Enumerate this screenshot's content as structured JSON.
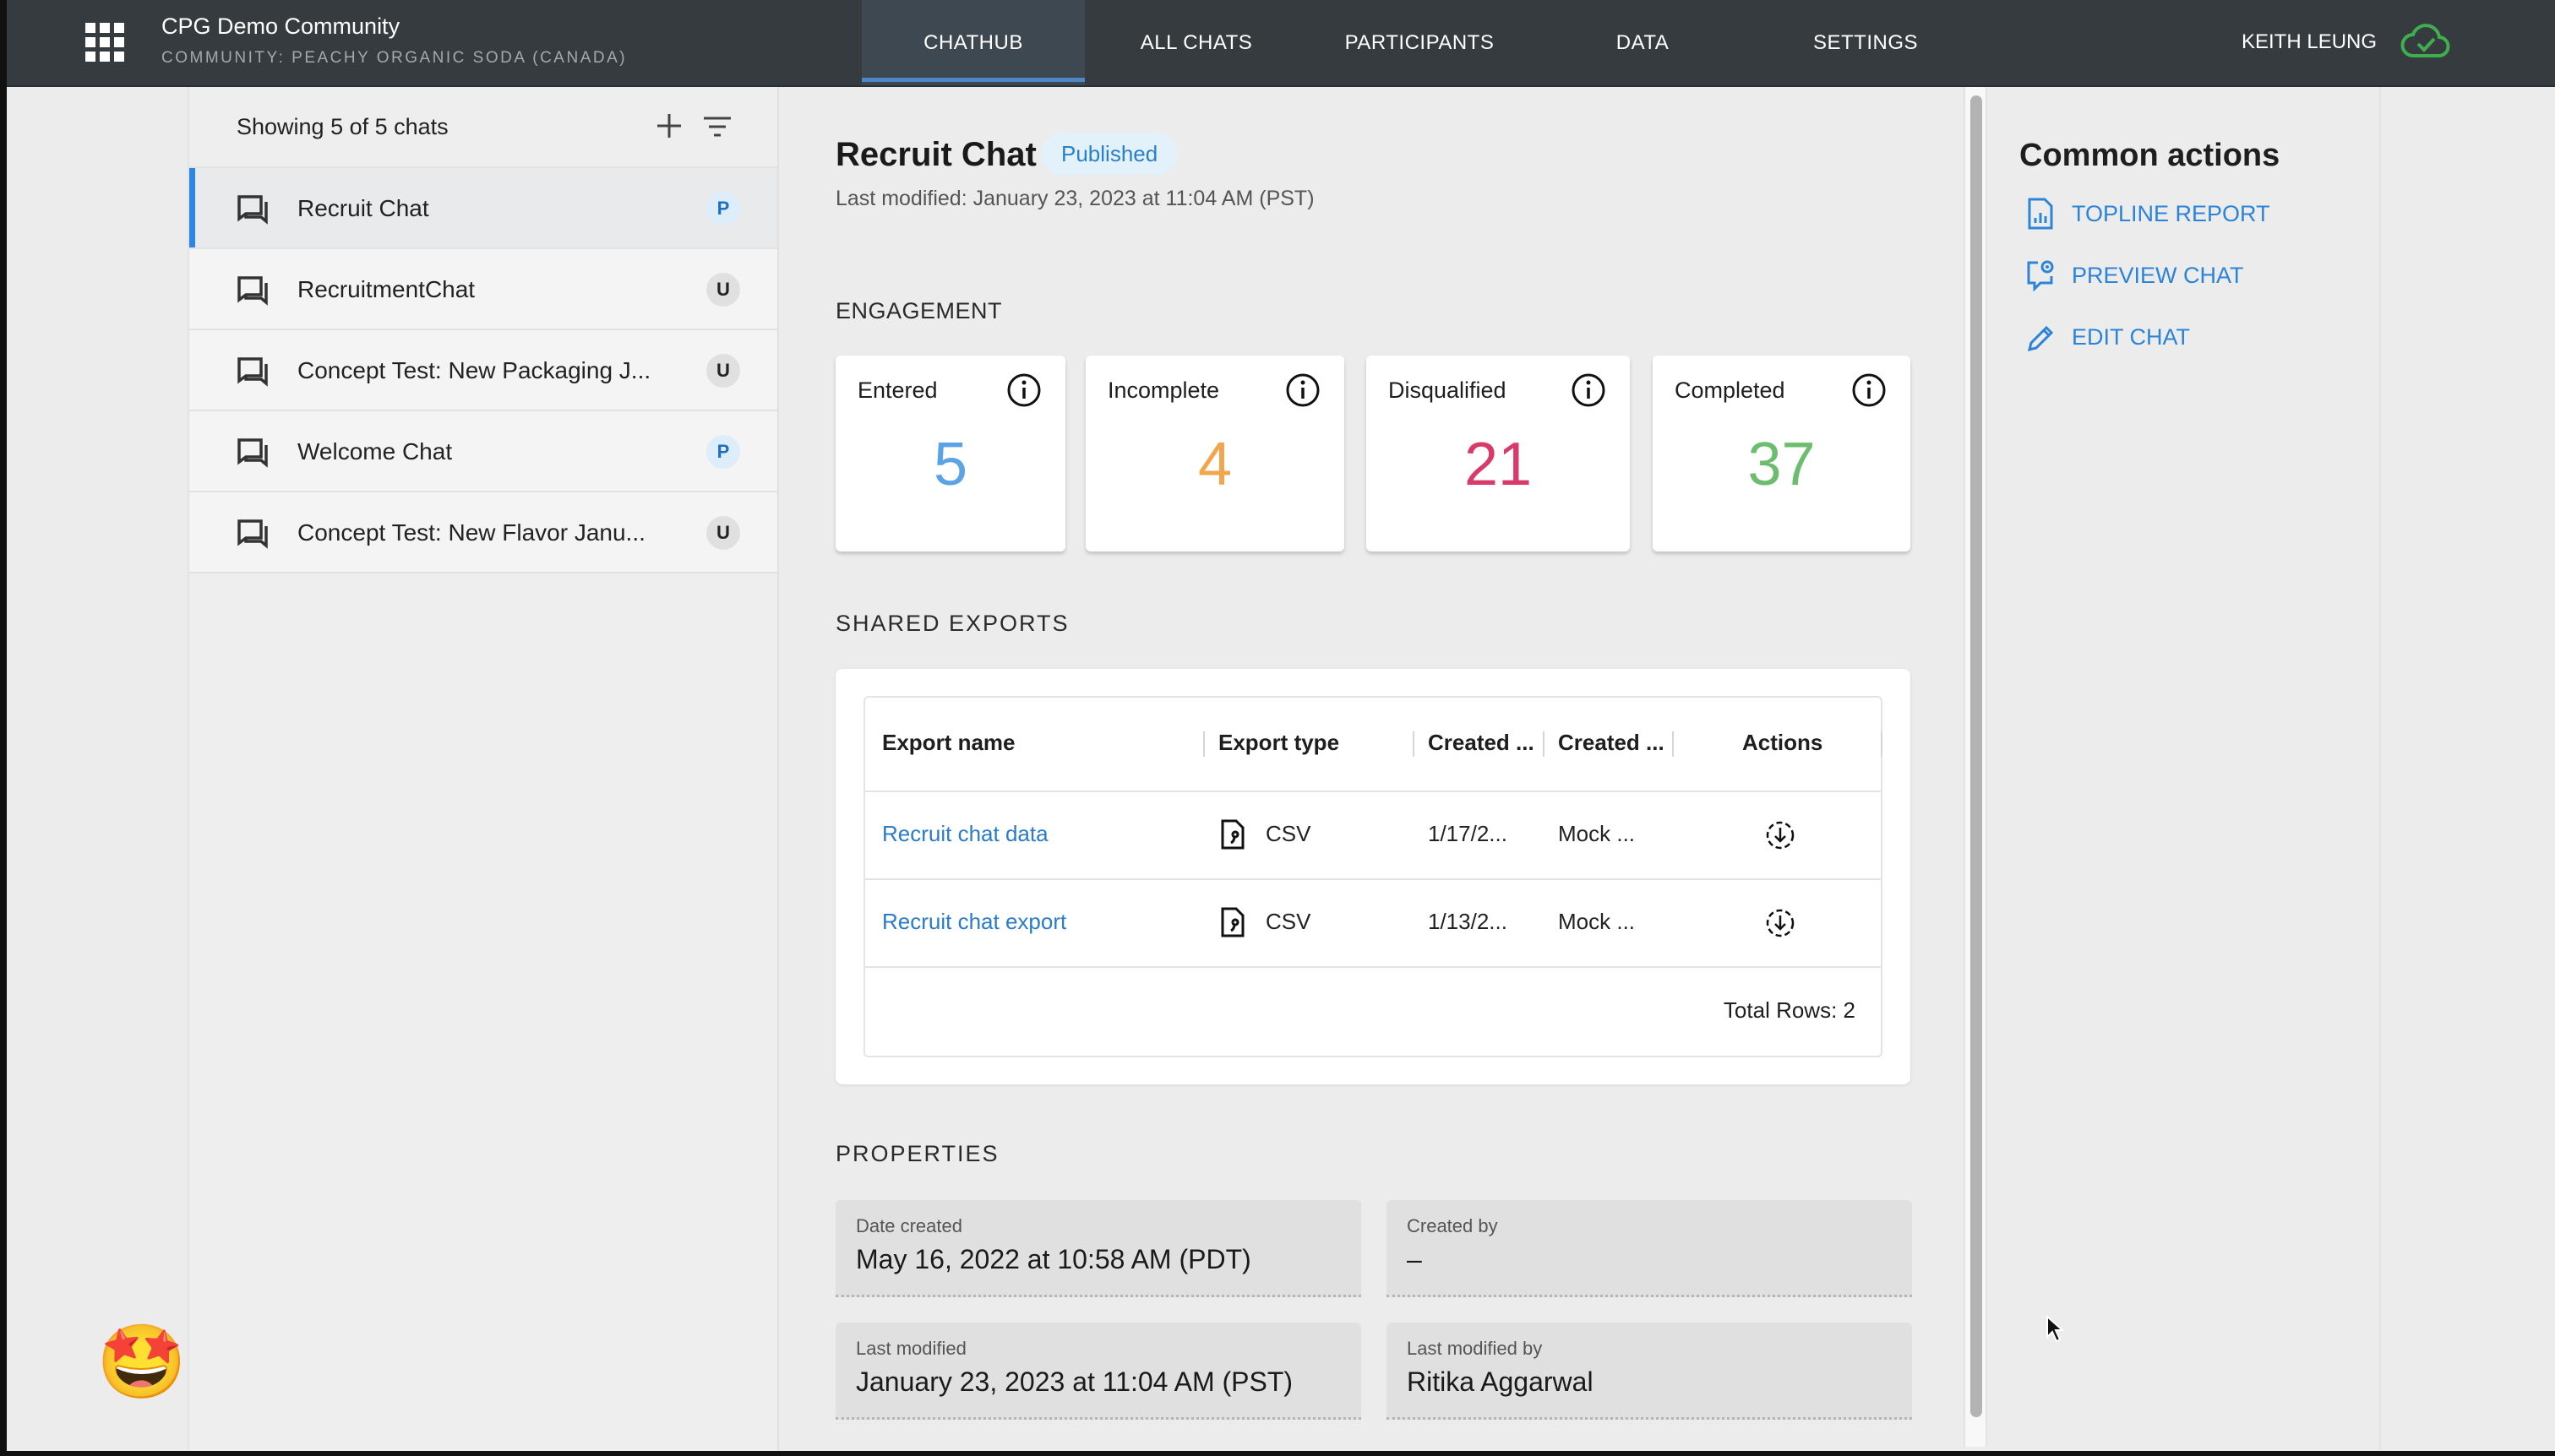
{
  "header": {
    "app_title": "CPG Demo Community",
    "community": "COMMUNITY: PEACHY ORGANIC SODA (CANADA)",
    "nav_tabs": [
      {
        "label": "CHATHUB",
        "active": true
      },
      {
        "label": "ALL CHATS",
        "active": false
      },
      {
        "label": "PARTICIPANTS",
        "active": false
      },
      {
        "label": "DATA",
        "active": false
      },
      {
        "label": "SETTINGS",
        "active": false
      }
    ],
    "user_name": "KEITH LEUNG",
    "sync_status_icon": "cloud-check-icon",
    "sync_color": "#3fae4f"
  },
  "sidebar": {
    "showing_text": "Showing 5 of 5 chats",
    "add_icon": "plus-icon",
    "filter_icon": "filter-icon",
    "chats": [
      {
        "name": "Recruit Chat",
        "badge": "P",
        "selected": true
      },
      {
        "name": "RecruitmentChat",
        "badge": "U",
        "selected": false
      },
      {
        "name": "Concept Test: New Packaging J...",
        "badge": "U",
        "selected": false
      },
      {
        "name": "Welcome Chat",
        "badge": "P",
        "selected": false
      },
      {
        "name": "Concept Test: New Flavor Janu...",
        "badge": "U",
        "selected": false
      }
    ],
    "emoji": "🤩"
  },
  "main": {
    "title": "Recruit Chat",
    "status": "Published",
    "last_modified": "Last modified: January 23, 2023 at 11:04 AM (PST)",
    "engagement_label": "ENGAGEMENT",
    "engagement": [
      {
        "label": "Entered",
        "value": "5",
        "color": "#5aa3e6"
      },
      {
        "label": "Incomplete",
        "value": "4",
        "color": "#f2a54a"
      },
      {
        "label": "Disqualified",
        "value": "21",
        "color": "#d83a6a"
      },
      {
        "label": "Completed",
        "value": "37",
        "color": "#6cbd6e"
      }
    ],
    "exports_label": "SHARED EXPORTS",
    "exports_table": {
      "columns": [
        "Export name",
        "Export type",
        "Created ...",
        "Created ...",
        "Actions"
      ],
      "rows": [
        {
          "name": "Recruit chat data",
          "type": "CSV",
          "created_date": "1/17/2...",
          "created_by": "Mock ...",
          "action_icon": "download-icon"
        },
        {
          "name": "Recruit chat export",
          "type": "CSV",
          "created_date": "1/13/2...",
          "created_by": "Mock ...",
          "action_icon": "download-icon"
        }
      ],
      "total_rows": "Total Rows: 2"
    },
    "properties_label": "PROPERTIES",
    "properties": [
      {
        "label": "Date created",
        "value": "May 16, 2022 at 10:58 AM (PDT)"
      },
      {
        "label": "Created by",
        "value": "–"
      },
      {
        "label": "Last modified",
        "value": "January 23, 2023 at 11:04 AM (PST)"
      },
      {
        "label": "Last modified by",
        "value": "Ritika Aggarwal"
      }
    ]
  },
  "common_actions": {
    "title": "Common actions",
    "items": [
      {
        "label": "TOPLINE REPORT",
        "icon": "report-icon"
      },
      {
        "label": "PREVIEW CHAT",
        "icon": "preview-chat-icon"
      },
      {
        "label": "EDIT CHAT",
        "icon": "pencil-icon"
      }
    ],
    "accent": "#2b84d8"
  }
}
